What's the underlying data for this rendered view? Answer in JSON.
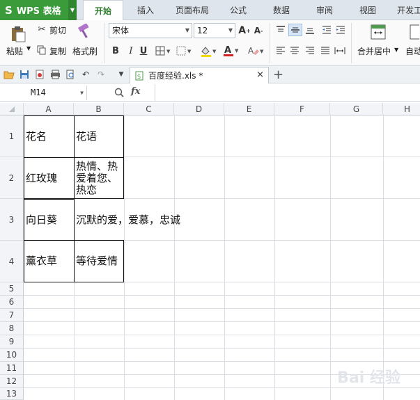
{
  "app": {
    "logo": "S",
    "title": "WPS 表格"
  },
  "tabs": [
    "开始",
    "插入",
    "页面布局",
    "公式",
    "数据",
    "审阅",
    "视图",
    "开发工"
  ],
  "ribbon": {
    "paste": "粘贴",
    "cut": "剪切",
    "copy": "复制",
    "format_painter": "格式刷",
    "font_name": "宋体",
    "font_size": "12",
    "merge_center": "合并居中",
    "auto_wrap": "自动"
  },
  "doc_tab": {
    "name": "百度经验.xls *"
  },
  "namebox": "M14",
  "fx": "fx",
  "columns": [
    "A",
    "B",
    "C",
    "D",
    "E",
    "F",
    "G",
    "H"
  ],
  "rows": [
    "1",
    "2",
    "3",
    "4",
    "5",
    "6",
    "7",
    "8",
    "9",
    "10",
    "11",
    "12",
    "13"
  ],
  "cells": {
    "a1": "花名",
    "b1": "花语",
    "a2": "红玫瑰",
    "b2": "热情、热爱着您、热恋",
    "a3": "向日葵",
    "b3": "沉默的爱，爱慕，忠诚",
    "a4": "薰衣草",
    "b4": "等待爱情"
  },
  "watermark": "Bai 经验"
}
